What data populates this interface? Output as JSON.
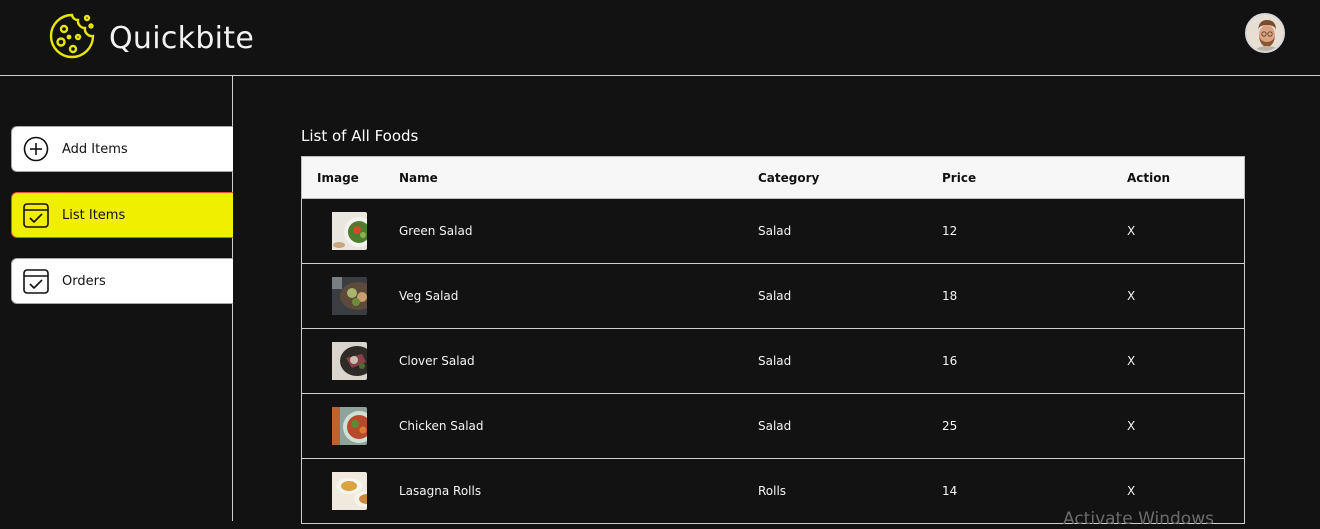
{
  "app": {
    "name": "Quickbite"
  },
  "sidebar": {
    "items": [
      {
        "label": "Add Items",
        "icon": "plus-circle-icon",
        "active": false
      },
      {
        "label": "List Items",
        "icon": "calendar-check-icon",
        "active": true
      },
      {
        "label": "Orders",
        "icon": "calendar-check-icon",
        "active": false
      }
    ]
  },
  "main": {
    "title": "List of All Foods",
    "columns": [
      "Image",
      "Name",
      "Category",
      "Price",
      "Action"
    ],
    "rows": [
      {
        "name": "Green Salad",
        "category": "Salad",
        "price": "12",
        "action": "X"
      },
      {
        "name": "Veg Salad",
        "category": "Salad",
        "price": "18",
        "action": "X"
      },
      {
        "name": "Clover Salad",
        "category": "Salad",
        "price": "16",
        "action": "X"
      },
      {
        "name": "Chicken Salad",
        "category": "Salad",
        "price": "25",
        "action": "X"
      },
      {
        "name": "Lasagna Rolls",
        "category": "Rolls",
        "price": "14",
        "action": "X"
      }
    ]
  },
  "watermark": "Activate Windows",
  "colors": {
    "accent": "#f1ef00",
    "logo": "#e6e60a",
    "active_border": "#e4533a"
  }
}
